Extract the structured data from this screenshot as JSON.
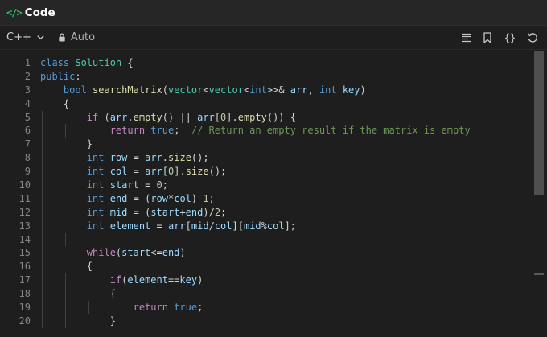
{
  "header": {
    "title": "Code",
    "icon": "code-icon"
  },
  "toolbar": {
    "language": "C++",
    "mode": "Auto",
    "icons": [
      "format-icon",
      "bookmark-icon",
      "braces-icon",
      "reset-icon"
    ],
    "braces_glyph": "{}"
  },
  "colors": {
    "accent": "#2cbb5d",
    "keyword": "#569cd6",
    "function": "#dcdcaa",
    "variable": "#9cdcfe",
    "comment": "#6a9955",
    "control": "#c586c0"
  },
  "code": {
    "line_numbers": [
      "1",
      "2",
      "3",
      "4",
      "5",
      "6",
      "7",
      "8",
      "9",
      "10",
      "11",
      "12",
      "13",
      "14",
      "15",
      "16",
      "17",
      "18",
      "19",
      "20"
    ],
    "lines": [
      [
        [
          "kw",
          "class"
        ],
        [
          "op",
          " "
        ],
        [
          "cls",
          "Solution"
        ],
        [
          "op",
          " {"
        ]
      ],
      [
        [
          "kw",
          "public"
        ],
        [
          "op",
          ":"
        ]
      ],
      [
        [
          "op",
          "    "
        ],
        [
          "ty",
          "bool"
        ],
        [
          "op",
          " "
        ],
        [
          "fn",
          "searchMatrix"
        ],
        [
          "op",
          "("
        ],
        [
          "tpl",
          "vector"
        ],
        [
          "op",
          "<"
        ],
        [
          "tpl",
          "vector"
        ],
        [
          "op",
          "<"
        ],
        [
          "ty",
          "int"
        ],
        [
          "op",
          ">>"
        ],
        [
          "op",
          "& "
        ],
        [
          "var",
          "arr"
        ],
        [
          "op",
          ", "
        ],
        [
          "ty",
          "int"
        ],
        [
          "op",
          " "
        ],
        [
          "var",
          "key"
        ],
        [
          "op",
          ")"
        ]
      ],
      [
        [
          "op",
          "    {"
        ]
      ],
      [
        [
          "op",
          "        "
        ],
        [
          "ctl",
          "if"
        ],
        [
          "op",
          " ("
        ],
        [
          "var",
          "arr"
        ],
        [
          "op",
          "."
        ],
        [
          "fn",
          "empty"
        ],
        [
          "op",
          "() || "
        ],
        [
          "var",
          "arr"
        ],
        [
          "op",
          "["
        ],
        [
          "num",
          "0"
        ],
        [
          "op",
          "]."
        ],
        [
          "fn",
          "empty"
        ],
        [
          "op",
          "()) {"
        ]
      ],
      [
        [
          "op",
          "            "
        ],
        [
          "ctl",
          "return"
        ],
        [
          "op",
          " "
        ],
        [
          "kw",
          "true"
        ],
        [
          "op",
          ";  "
        ],
        [
          "cm",
          "// Return an empty result if the matrix is empty"
        ]
      ],
      [
        [
          "op",
          "        }"
        ]
      ],
      [
        [
          "op",
          "        "
        ],
        [
          "ty",
          "int"
        ],
        [
          "op",
          " "
        ],
        [
          "var",
          "row"
        ],
        [
          "op",
          " = "
        ],
        [
          "var",
          "arr"
        ],
        [
          "op",
          "."
        ],
        [
          "fn",
          "size"
        ],
        [
          "op",
          "();"
        ]
      ],
      [
        [
          "op",
          "        "
        ],
        [
          "ty",
          "int"
        ],
        [
          "op",
          " "
        ],
        [
          "var",
          "col"
        ],
        [
          "op",
          " = "
        ],
        [
          "var",
          "arr"
        ],
        [
          "op",
          "["
        ],
        [
          "num",
          "0"
        ],
        [
          "op",
          "]."
        ],
        [
          "fn",
          "size"
        ],
        [
          "op",
          "();"
        ]
      ],
      [
        [
          "op",
          "        "
        ],
        [
          "ty",
          "int"
        ],
        [
          "op",
          " "
        ],
        [
          "var",
          "start"
        ],
        [
          "op",
          " = "
        ],
        [
          "num",
          "0"
        ],
        [
          "op",
          ";"
        ]
      ],
      [
        [
          "op",
          "        "
        ],
        [
          "ty",
          "int"
        ],
        [
          "op",
          " "
        ],
        [
          "var",
          "end"
        ],
        [
          "op",
          " = ("
        ],
        [
          "var",
          "row"
        ],
        [
          "op",
          "*"
        ],
        [
          "var",
          "col"
        ],
        [
          "op",
          ")-"
        ],
        [
          "num",
          "1"
        ],
        [
          "op",
          ";"
        ]
      ],
      [
        [
          "op",
          "        "
        ],
        [
          "ty",
          "int"
        ],
        [
          "op",
          " "
        ],
        [
          "var",
          "mid"
        ],
        [
          "op",
          " = ("
        ],
        [
          "var",
          "start"
        ],
        [
          "op",
          "+"
        ],
        [
          "var",
          "end"
        ],
        [
          "op",
          ")/"
        ],
        [
          "num",
          "2"
        ],
        [
          "op",
          ";"
        ]
      ],
      [
        [
          "op",
          "        "
        ],
        [
          "ty",
          "int"
        ],
        [
          "op",
          " "
        ],
        [
          "var",
          "element"
        ],
        [
          "op",
          " = "
        ],
        [
          "var",
          "arr"
        ],
        [
          "op",
          "["
        ],
        [
          "var",
          "mid"
        ],
        [
          "op",
          "/"
        ],
        [
          "var",
          "col"
        ],
        [
          "op",
          "]["
        ],
        [
          "var",
          "mid"
        ],
        [
          "op",
          "%"
        ],
        [
          "var",
          "col"
        ],
        [
          "op",
          "];"
        ]
      ],
      [
        [
          "op",
          ""
        ]
      ],
      [
        [
          "op",
          "        "
        ],
        [
          "ctl",
          "while"
        ],
        [
          "op",
          "("
        ],
        [
          "var",
          "start"
        ],
        [
          "op",
          "<="
        ],
        [
          "var",
          "end"
        ],
        [
          "op",
          ")"
        ]
      ],
      [
        [
          "op",
          "        {"
        ]
      ],
      [
        [
          "op",
          "            "
        ],
        [
          "ctl",
          "if"
        ],
        [
          "op",
          "("
        ],
        [
          "var",
          "element"
        ],
        [
          "op",
          "=="
        ],
        [
          "var",
          "key"
        ],
        [
          "op",
          ")"
        ]
      ],
      [
        [
          "op",
          "            {"
        ]
      ],
      [
        [
          "op",
          "                "
        ],
        [
          "ctl",
          "return"
        ],
        [
          "op",
          " "
        ],
        [
          "kw",
          "true"
        ],
        [
          "op",
          ";"
        ]
      ],
      [
        [
          "op",
          "            }"
        ]
      ]
    ]
  }
}
